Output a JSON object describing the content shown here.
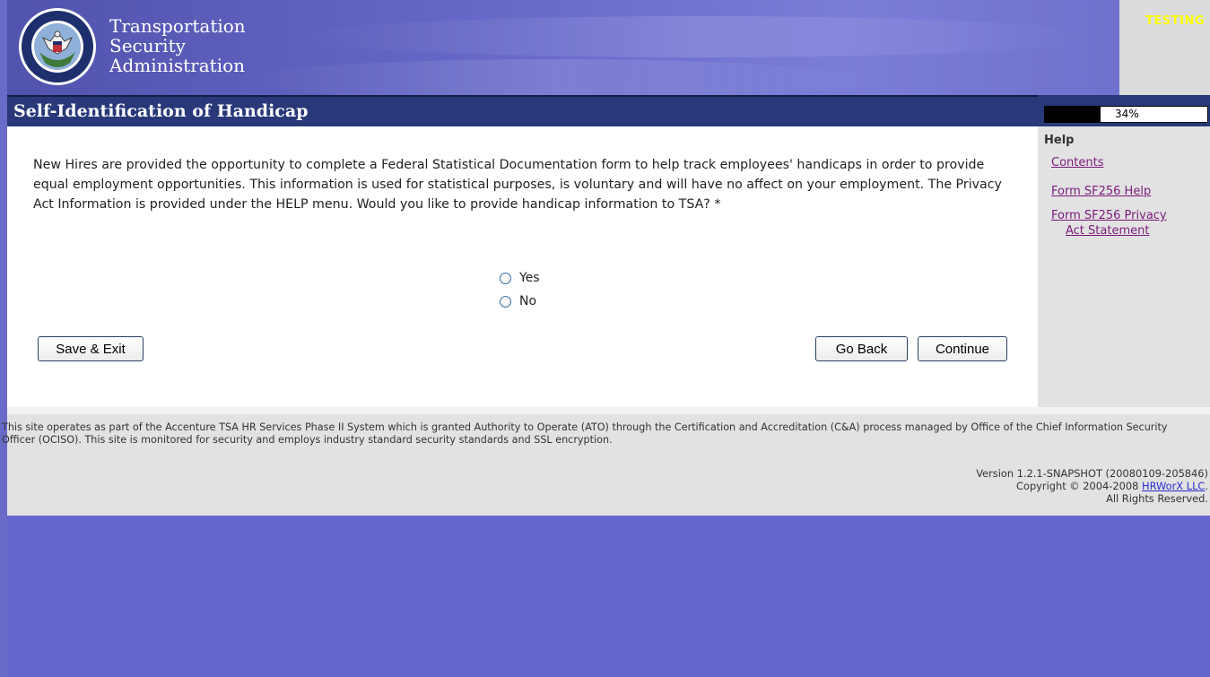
{
  "header": {
    "agency_line1": "Transportation",
    "agency_line2": "Security",
    "agency_line3": "Administration",
    "testing_label": "TESTING"
  },
  "title_bar": {
    "title": "Self-Identification of Handicap"
  },
  "progress": {
    "percent_label": "34%",
    "value": 0.34
  },
  "main": {
    "intro": "New Hires are provided the opportunity to complete a Federal Statistical Documentation form to help track employees' handicaps in order to provide equal employment opportunities. This information is used for statistical purposes, is voluntary and will have no affect on your employment. The Privacy Act Information is provided under the HELP menu. Would you like to provide handicap information to TSA? *",
    "options": [
      "Yes",
      "No"
    ],
    "save_exit_label": "Save & Exit",
    "go_back_label": "Go Back",
    "continue_label": "Continue"
  },
  "sidebar": {
    "heading": "Help",
    "contents_link": "Contents",
    "sf256_help_link": "Form SF256 Help",
    "sf256_privacy_line1": "Form SF256 Privacy",
    "sf256_privacy_line2": "Act Statement"
  },
  "footer": {
    "notice": "This site operates as part of the Accenture TSA HR Services Phase II System which is granted Authority to Operate (ATO) through the Certification and Accreditation (C&A) process managed by Office of the Chief Information Security Officer (OCISO). This site is monitored for security and employs industry standard security standards and SSL encryption.",
    "version": "Version 1.2.1-SNAPSHOT (20080109-205846)",
    "copyright_prefix": "Copyright © 2004-2008",
    "company_link": "HRWorX LLC",
    "copyright_suffix": ".",
    "rights": "All Rights Reserved."
  },
  "colors": {
    "page_background": "#6666cc",
    "title_bar": "#283878",
    "testing_text": "#ffff00",
    "link_visited": "#7a1a7a"
  },
  "icons": {
    "seal": "dhs-seal-icon"
  }
}
